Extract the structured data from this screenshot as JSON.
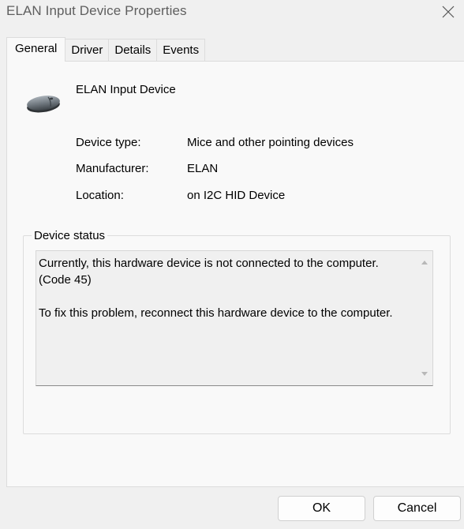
{
  "window": {
    "title": "ELAN Input Device Properties",
    "close_icon": "close-icon"
  },
  "tabs": [
    {
      "label": "General",
      "active": true
    },
    {
      "label": "Driver",
      "active": false
    },
    {
      "label": "Details",
      "active": false
    },
    {
      "label": "Events",
      "active": false
    }
  ],
  "device": {
    "icon": "mouse-icon",
    "name": "ELAN Input Device"
  },
  "properties": [
    {
      "label": "Device type:",
      "value": "Mice and other pointing devices"
    },
    {
      "label": "Manufacturer:",
      "value": "ELAN"
    },
    {
      "label": "Location:",
      "value": "on I2C HID Device"
    }
  ],
  "status": {
    "legend": "Device status",
    "text": "Currently, this hardware device is not connected to the computer. (Code 45)\n\nTo fix this problem, reconnect this hardware device to the computer."
  },
  "buttons": {
    "ok": "OK",
    "cancel": "Cancel"
  },
  "colors": {
    "background": "#f0f0f0",
    "panel": "#f9f9f9",
    "title_text": "#5f5f5f"
  }
}
